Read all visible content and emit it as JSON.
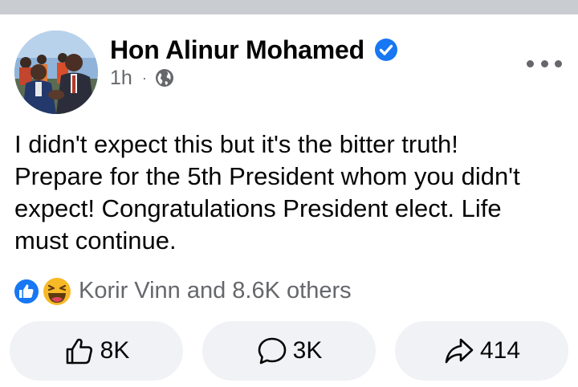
{
  "post": {
    "author": "Hon Alinur Mohamed",
    "time": "1h",
    "separator": "·",
    "text": "I didn't expect this but it's the bitter truth! Prepare for the 5th President whom you didn't expect! Congratulations President elect. Life must continue."
  },
  "reactions": {
    "summary": "Korir Vinn and 8.6K others",
    "icons": [
      "like-reaction",
      "haha-reaction"
    ]
  },
  "actions": {
    "like_count": "8K",
    "comment_count": "3K",
    "share_count": "414"
  },
  "colors": {
    "facebook_blue": "#1877f2",
    "secondary_text": "#65676b",
    "button_bg": "#f0f2f5",
    "top_strip": "#c9ccd1"
  },
  "icons": {
    "verified": "verified-badge-icon",
    "audience": "globe-icon",
    "more": "more-options-icon",
    "like": "thumbs-up-icon",
    "comment": "comment-bubble-icon",
    "share": "share-arrow-icon"
  }
}
